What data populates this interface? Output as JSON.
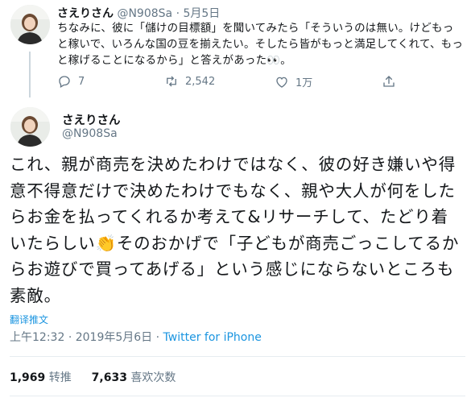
{
  "reply_tweet": {
    "display_name": "さえりさん",
    "handle": "@N908Sa",
    "date_sep": "·",
    "date": "5月5日",
    "text": "ちなみに、彼に「儲けの目標額」を聞いてみたら「そういうのは無い。けどもっと稼いで、いろんな国の豆を揃えたい。そしたら皆がもっと満足してくれて、もっと稼げることになるから」と答えがあった👀。",
    "reply_count": "7",
    "retweet_count": "2,542",
    "like_count": "1万"
  },
  "main_tweet": {
    "display_name": "さえりさん",
    "handle": "@N908Sa",
    "text": "これ、親が商売を決めたわけではなく、彼の好き嫌いや得意不得意だけで決めたわけでもなく、親や大人が何をしたらお金を払ってくれるか考えて&リサーチして、たどり着いたらしい👏そのおかげで「子どもが商売ごっこしてるからお遊びで買ってあげる」という感じにならないところも素敵。",
    "translate_label": "翻译推文",
    "time": "上午12:32",
    "date": "2019年5月6日",
    "meta_sep": "·",
    "source": "Twitter for iPhone",
    "retweets_value": "1,969",
    "retweets_label": "转推",
    "likes_value": "7,633",
    "likes_label": "喜欢次数"
  },
  "icons": {
    "reply": "reply-icon",
    "retweet": "retweet-icon",
    "like": "heart-icon",
    "share": "share-icon"
  },
  "colors": {
    "text": "#14171a",
    "secondary": "#657786",
    "link": "#1b95e0",
    "line": "#ccd6dd"
  }
}
